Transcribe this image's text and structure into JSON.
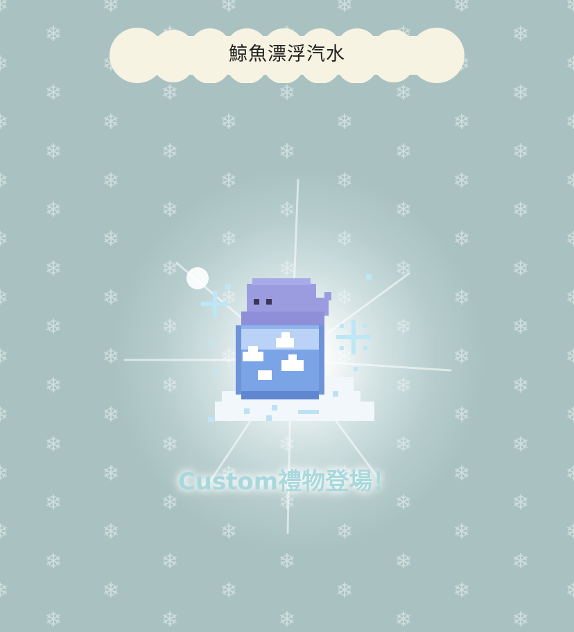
{
  "title_banner": {
    "text": "鯨魚漂浮汽水"
  },
  "caption": {
    "text": "Custom禮物登場！"
  },
  "item": {
    "icon": "whale-soda-icon"
  },
  "background": {
    "pattern_icon": "snowflake-icon",
    "color": "#a9c2c1"
  }
}
